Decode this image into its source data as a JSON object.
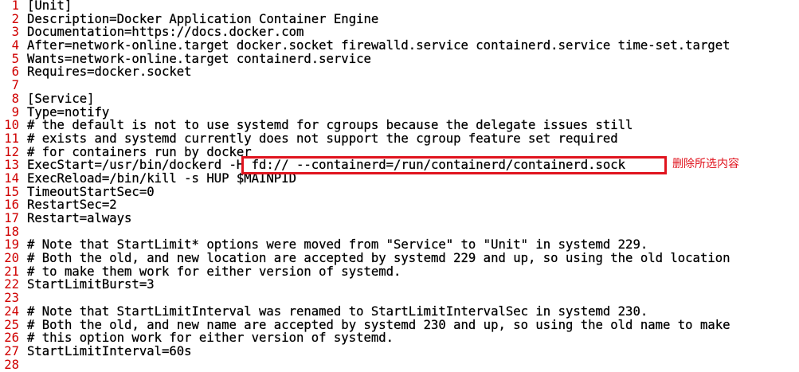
{
  "editor": {
    "lines": [
      {
        "number": "1",
        "text": "[Unit]"
      },
      {
        "number": "2",
        "text": "Description=Docker Application Container Engine"
      },
      {
        "number": "3",
        "text": "Documentation=https://docs.docker.com"
      },
      {
        "number": "4",
        "text": "After=network-online.target docker.socket firewalld.service containerd.service time-set.target"
      },
      {
        "number": "5",
        "text": "Wants=network-online.target containerd.service"
      },
      {
        "number": "6",
        "text": "Requires=docker.socket"
      },
      {
        "number": "7",
        "text": ""
      },
      {
        "number": "8",
        "text": "[Service]"
      },
      {
        "number": "9",
        "text": "Type=notify"
      },
      {
        "number": "10",
        "text": "# the default is not to use systemd for cgroups because the delegate issues still"
      },
      {
        "number": "11",
        "text": "# exists and systemd currently does not support the cgroup feature set required"
      },
      {
        "number": "12",
        "text": "# for containers run by docker"
      },
      {
        "number": "13",
        "text": "ExecStart=/usr/bin/dockerd -H fd:// --containerd=/run/containerd/containerd.sock"
      },
      {
        "number": "14",
        "text": "ExecReload=/bin/kill -s HUP $MAINPID"
      },
      {
        "number": "15",
        "text": "TimeoutStartSec=0"
      },
      {
        "number": "16",
        "text": "RestartSec=2"
      },
      {
        "number": "17",
        "text": "Restart=always"
      },
      {
        "number": "18",
        "text": ""
      },
      {
        "number": "19",
        "text": "# Note that StartLimit* options were moved from \"Service\" to \"Unit\" in systemd 229."
      },
      {
        "number": "20",
        "text": "# Both the old, and new location are accepted by systemd 229 and up, so using the old location"
      },
      {
        "number": "21",
        "text": "# to make them work for either version of systemd."
      },
      {
        "number": "22",
        "text": "StartLimitBurst=3"
      },
      {
        "number": "23",
        "text": ""
      },
      {
        "number": "24",
        "text": "# Note that StartLimitInterval was renamed to StartLimitIntervalSec in systemd 230."
      },
      {
        "number": "25",
        "text": "# Both the old, and new name are accepted by systemd 230 and up, so using the old name to make"
      },
      {
        "number": "26",
        "text": "# this option work for either version of systemd."
      },
      {
        "number": "27",
        "text": "StartLimitInterval=60s"
      },
      {
        "number": "28",
        "text": ""
      }
    ]
  },
  "annotation": {
    "text": "删除所选内容",
    "color": "#e0141e"
  },
  "colors": {
    "line_number": "#d00000",
    "text": "#000000",
    "background": "#ffffff"
  }
}
